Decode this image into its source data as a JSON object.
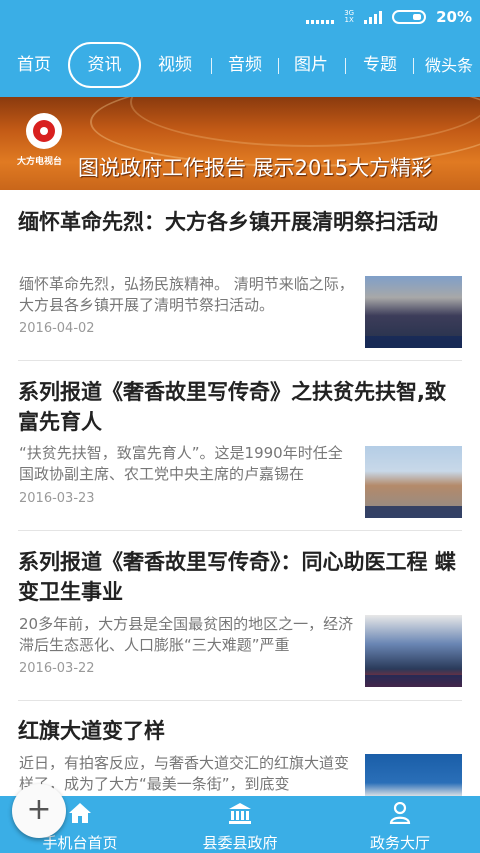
{
  "status_bar": {
    "network_top": "3G",
    "network_bottom": "1X",
    "battery": "20%"
  },
  "nav": {
    "items": [
      {
        "label": "首页"
      },
      {
        "label": "资讯"
      },
      {
        "label": "视频"
      },
      {
        "label": "音频"
      },
      {
        "label": "图片"
      },
      {
        "label": "专题"
      },
      {
        "label": "微头条"
      }
    ],
    "active_index": 1
  },
  "banner": {
    "station": "大方电视台",
    "title": "图说政府工作报告 展示2015大方精彩"
  },
  "articles": [
    {
      "title": "缅怀革命先烈：大方各乡镇开展清明祭扫活动",
      "summary": "缅怀革命先烈，弘扬民族精神。 清明节来临之际，大方县各乡镇开展了清明节祭扫活动。",
      "date": "2016-04-02"
    },
    {
      "title": "系列报道《奢香故里写传奇》之扶贫先扶智,致富先育人",
      "summary": "“扶贫先扶智，致富先育人”。这是1990年时任全国政协副主席、农工党中央主席的卢嘉锡在",
      "date": "2016-03-23"
    },
    {
      "title": "系列报道《奢香故里写传奇》：同心助医工程 蝶变卫生事业",
      "summary": "20多年前，大方县是全国最贫困的地区之一，经济滞后生态恶化、人口膨胀“三大难题”严重",
      "date": "2016-03-22"
    },
    {
      "title": "红旗大道变了样",
      "summary": "近日，有拍客反应，与奢香大道交汇的红旗大道变样了，成为了大方“最美一条街”，到底变",
      "date": ""
    }
  ],
  "bottom_tabs": [
    {
      "label": "手机台首页",
      "icon": "home-icon"
    },
    {
      "label": "县委县政府",
      "icon": "government-building-icon"
    },
    {
      "label": "政务大厅",
      "icon": "person-icon"
    }
  ],
  "fab": {
    "symbol": "+"
  },
  "colors": {
    "primary": "#3aaee6",
    "title": "#222222",
    "summary": "#777777",
    "date": "#999999"
  }
}
